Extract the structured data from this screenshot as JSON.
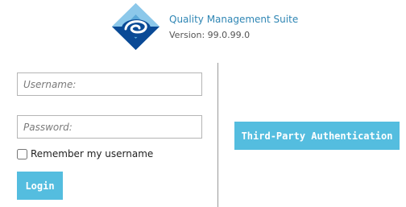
{
  "brand": {
    "title": "Quality Management Suite",
    "version": "Version: 99.0.99.0"
  },
  "login_form": {
    "username_placeholder": "Username:",
    "password_placeholder": "Password:",
    "remember_label": "Remember my username",
    "remember_checked": false,
    "login_label": "Login"
  },
  "third_party": {
    "button_label": "Third-Party Authentication"
  },
  "colors": {
    "accent": "#54bddf",
    "brand_text": "#2f86b4",
    "logo_blue": "#0a4a96",
    "logo_light": "#5aa8d8"
  },
  "icons": {
    "logo": "diamond-swirl-logo"
  }
}
